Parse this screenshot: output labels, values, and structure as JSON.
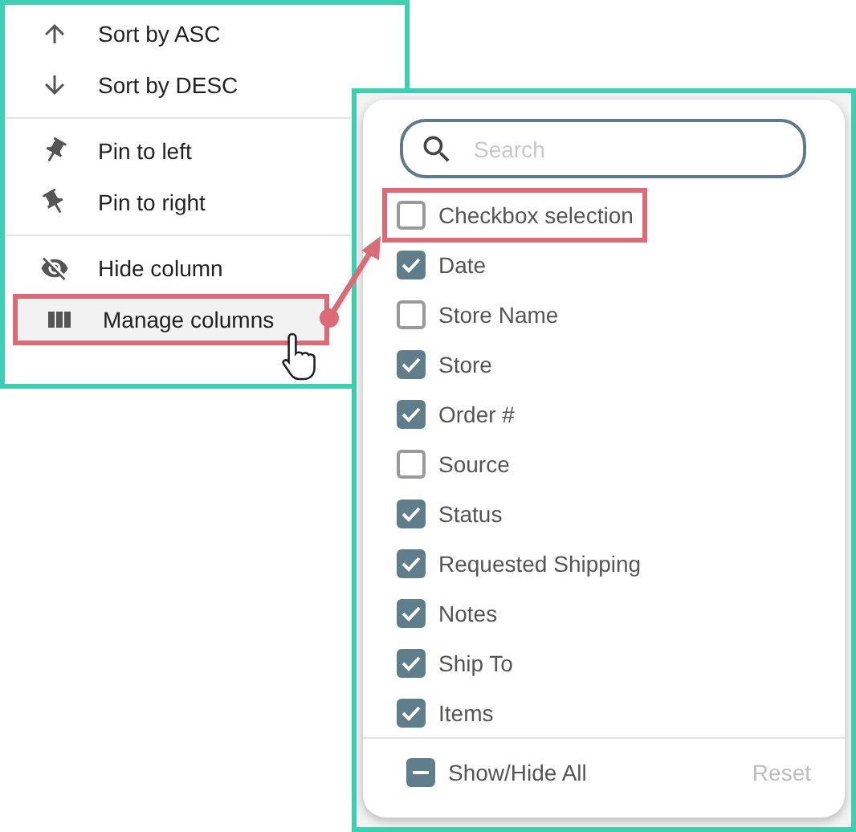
{
  "column_menu": {
    "groups": [
      {
        "items": [
          {
            "label": "Sort by ASC",
            "highlighted": false
          },
          {
            "label": "Sort by DESC",
            "highlighted": false
          }
        ]
      },
      {
        "items": [
          {
            "label": "Pin to left",
            "highlighted": false
          },
          {
            "label": "Pin to right",
            "highlighted": false
          }
        ]
      },
      {
        "items": [
          {
            "label": "Hide column",
            "highlighted": false
          },
          {
            "label": "Manage columns",
            "highlighted": true
          }
        ]
      }
    ]
  },
  "columns_panel": {
    "search": {
      "placeholder": "Search"
    },
    "columns": [
      {
        "label": "Checkbox selection",
        "checked": false,
        "highlighted": true
      },
      {
        "label": "Date",
        "checked": true,
        "highlighted": false
      },
      {
        "label": "Store Name",
        "checked": false,
        "highlighted": false
      },
      {
        "label": "Store",
        "checked": true,
        "highlighted": false
      },
      {
        "label": "Order #",
        "checked": true,
        "highlighted": false
      },
      {
        "label": "Source",
        "checked": false,
        "highlighted": false
      },
      {
        "label": "Status",
        "checked": true,
        "highlighted": false
      },
      {
        "label": "Requested Shipping",
        "checked": true,
        "highlighted": false
      },
      {
        "label": "Notes",
        "checked": true,
        "highlighted": false
      },
      {
        "label": "Ship To",
        "checked": true,
        "highlighted": false
      },
      {
        "label": "Items",
        "checked": true,
        "highlighted": false
      }
    ],
    "show_hide_all": {
      "label": "Show/Hide All",
      "indeterminate": true
    },
    "reset": {
      "label": "Reset",
      "disabled": true
    }
  }
}
